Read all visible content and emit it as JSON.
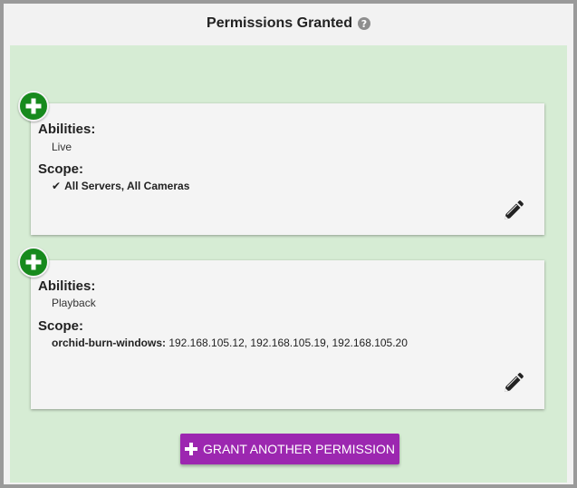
{
  "header": {
    "title": "Permissions Granted",
    "help_icon": "question-circle-icon",
    "help_glyph": "?"
  },
  "colors": {
    "panel_bg": "#d6ecd4",
    "add_button": "#178a1d",
    "grant_button": "#9c27b0"
  },
  "permissions": [
    {
      "abilities_label": "Abilities:",
      "abilities_value": "Live",
      "scope_label": "Scope:",
      "scope_check_icon": "check-icon",
      "scope_value": "All Servers, All Cameras",
      "edit_icon": "pencil-icon"
    },
    {
      "abilities_label": "Abilities:",
      "abilities_value": "Playback",
      "scope_label": "Scope:",
      "scope_server": "orchid-burn-windows:",
      "scope_value": "192.168.105.12, 192.168.105.19, 192.168.105.20",
      "edit_icon": "pencil-icon"
    }
  ],
  "footer": {
    "grant_label": "GRANT ANOTHER PERMISSION",
    "grant_icon": "plus-icon"
  }
}
